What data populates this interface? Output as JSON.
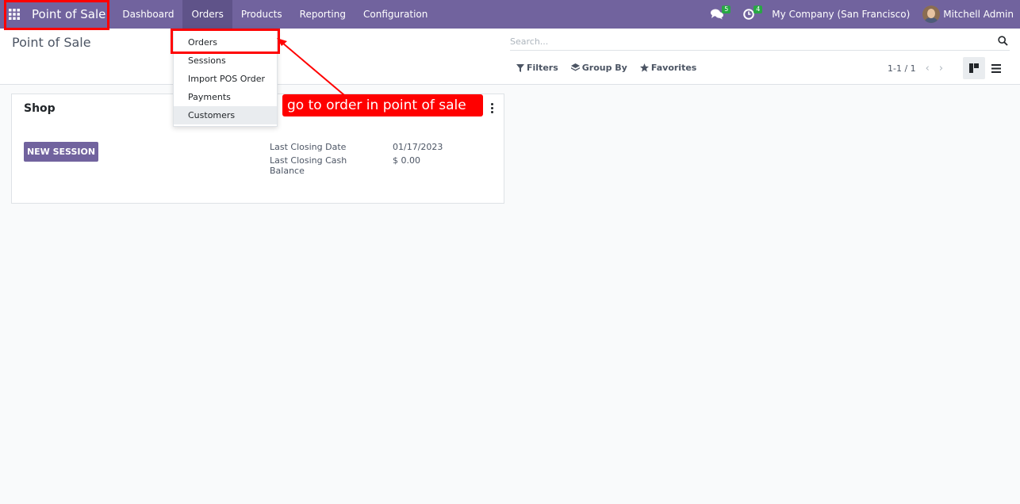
{
  "navbar": {
    "app_name": "Point of Sale",
    "menu": [
      "Dashboard",
      "Orders",
      "Products",
      "Reporting",
      "Configuration"
    ],
    "messages_count": "5",
    "activities_count": "4",
    "company": "My Company (San Francisco)",
    "user": "Mitchell Admin"
  },
  "control_panel": {
    "title": "Point of Sale",
    "search_placeholder": "Search...",
    "filters_label": "Filters",
    "groupby_label": "Group By",
    "favorites_label": "Favorites",
    "pager": "1-1 / 1"
  },
  "orders_menu": {
    "items": [
      "Orders",
      "Sessions",
      "Import POS Order",
      "Payments",
      "Customers"
    ]
  },
  "card": {
    "title": "Shop",
    "new_session_label": "NEW SESSION",
    "last_closing_date_label": "Last Closing Date",
    "last_closing_date": "01/17/2023",
    "last_closing_cash_label": "Last Closing Cash Balance",
    "last_closing_cash": "$ 0.00"
  },
  "annotation": {
    "text": "go to order in point of sale",
    "color": "#ff0000"
  },
  "theme": {
    "brand": "#71639e",
    "badge_green": "#28a745"
  }
}
